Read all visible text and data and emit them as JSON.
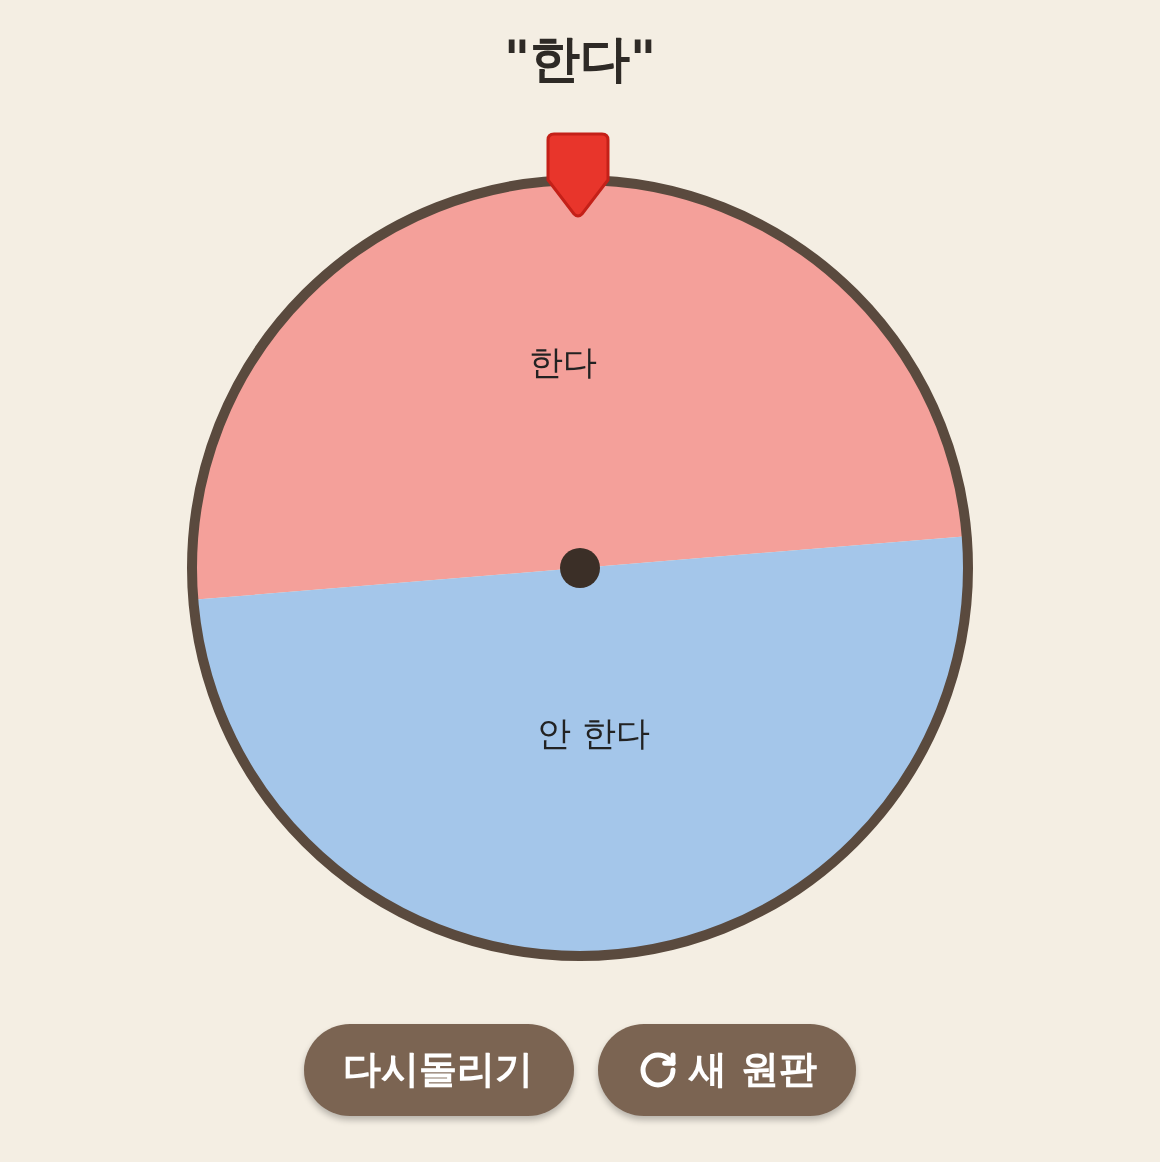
{
  "result": {
    "title": "\"한다\""
  },
  "wheel": {
    "slices": [
      {
        "label": "한다",
        "color": "#f4a09a"
      },
      {
        "label": "안 한다",
        "color": "#a4c6ea"
      }
    ]
  },
  "buttons": [
    {
      "label": "다시돌리기",
      "kind": "plain"
    },
    {
      "label": "새 원판",
      "kind": "refresh"
    }
  ]
}
